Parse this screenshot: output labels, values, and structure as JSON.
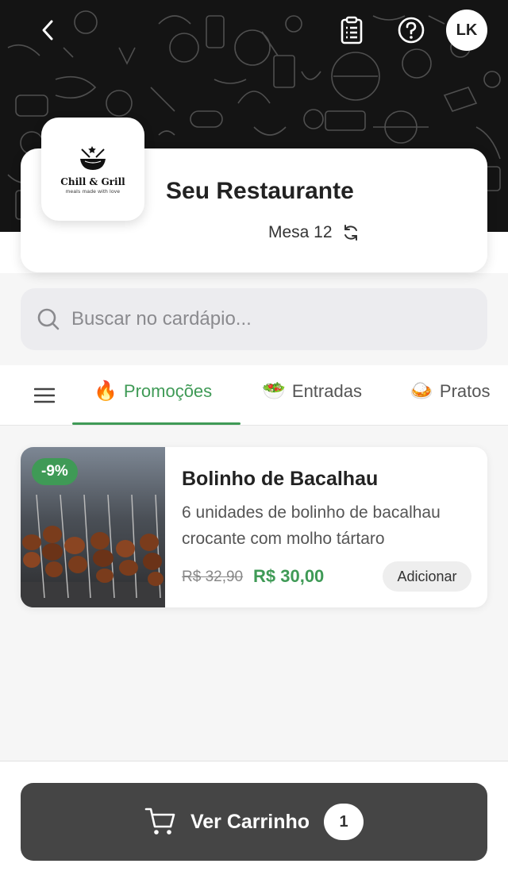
{
  "header": {
    "avatar_initials": "LK"
  },
  "restaurant": {
    "logo_name": "Chill & Grill",
    "logo_tagline": "meals made with love",
    "name": "Seu Restaurante",
    "table": "Mesa 12"
  },
  "search": {
    "placeholder": "Buscar no cardápio..."
  },
  "tabs": [
    {
      "label": "Promoções",
      "emoji": "🔥",
      "active": true
    },
    {
      "label": "Entradas",
      "emoji": "🥗",
      "active": false
    },
    {
      "label": "Pratos",
      "emoji": "🍛",
      "active": false
    }
  ],
  "products": [
    {
      "discount": "-9%",
      "name": "Bolinho de Bacalhau",
      "description": "6 unidades de bolinho de bacalhau crocante com molho tártaro",
      "old_price": "R$ 32,90",
      "price": "R$ 30,00",
      "add_label": "Adicionar"
    }
  ],
  "cart": {
    "label": "Ver Carrinho",
    "count": "1"
  },
  "colors": {
    "accent": "#3f9a56",
    "cart_button": "#454545",
    "banner": "#141414"
  },
  "icons": [
    "chevron-left-icon",
    "clipboard-icon",
    "help-icon",
    "refresh-icon",
    "search-icon",
    "hamburger-icon",
    "cart-icon"
  ]
}
